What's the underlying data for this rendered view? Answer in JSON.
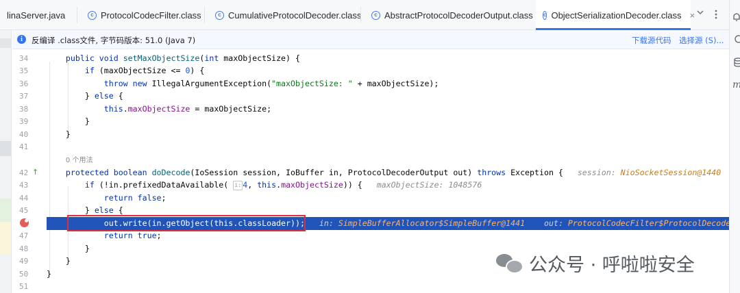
{
  "tabs": [
    {
      "label": "linaServer.java",
      "active": false,
      "icon": "none"
    },
    {
      "label": "ProtocolCodecFilter.class",
      "active": false,
      "icon": "class-icon"
    },
    {
      "label": "CumulativeProtocolDecoder.class",
      "active": false,
      "icon": "class-icon"
    },
    {
      "label": "AbstractProtocolDecoderOutput.class",
      "active": false,
      "icon": "class-icon"
    },
    {
      "label": "ObjectSerializationDecoder.class",
      "active": true,
      "icon": "class-icon"
    }
  ],
  "tab_close_glyph": "×",
  "tab_overflow_icon": "chevron-down-icon",
  "tab_menu_icon": "more-vertical-icon",
  "banner": {
    "text": "反编译 .class文件, 字节码版本: 51.0 (Java 7)",
    "download_link": "下载源代码",
    "choose_source_link": "选择源 (S)..."
  },
  "line_numbers": [
    "34",
    "35",
    "36",
    "37",
    "38",
    "39",
    "40",
    "41",
    "42",
    "43",
    "44",
    "45",
    "46",
    "47",
    "48",
    "49",
    "50",
    "51"
  ],
  "usage_hint": "0 个用法",
  "param_badge": "i:",
  "inline_hints": {
    "session_label": "session:",
    "session_value": "NioSocketSession@1440",
    "in_label_cut": "in",
    "maxsize_label": "maxObjectSize:",
    "maxsize_value": "1048576",
    "in_label": "in:",
    "in_value": "SimpleBufferAllocator$SimpleBuffer@1441",
    "out_label": "out:",
    "out_value": "ProtocolCodecFilter$ProtocolDecoderOut"
  },
  "watermark": {
    "text": "公众号 · 呼啦啦安全",
    "icon": "wechat-logo"
  },
  "colors": {
    "highlight_line": "#2154b8",
    "annotation_box": "#e02d3c",
    "keyword": "#0033b3",
    "accent": "#3574f0"
  }
}
